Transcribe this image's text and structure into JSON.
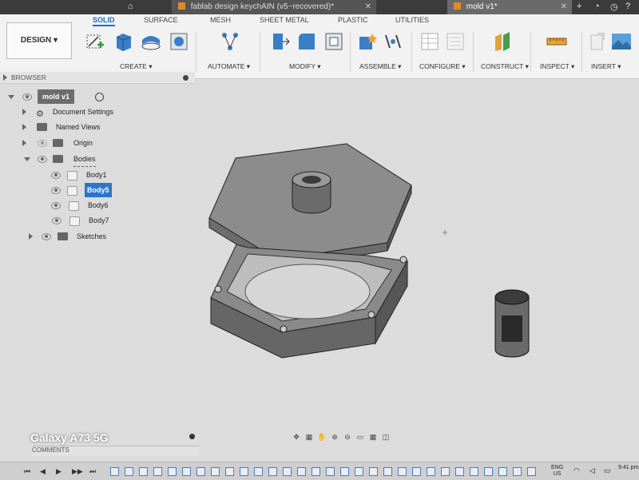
{
  "tabs": {
    "inactive_title": "fablab design keychAIN (v5~recovered)*",
    "active_title": "mold v1*"
  },
  "ribbon": {
    "design_label": "DESIGN ▾",
    "tabs": [
      "SOLID",
      "SURFACE",
      "MESH",
      "SHEET METAL",
      "PLASTIC",
      "UTILITIES"
    ],
    "groups": [
      "CREATE ▾",
      "AUTOMATE ▾",
      "MODIFY ▾",
      "ASSEMBLE ▾",
      "CONFIGURE ▾",
      "CONSTRUCT ▾",
      "INSPECT ▾",
      "INSERT ▾"
    ]
  },
  "browser": {
    "title": "BROWSER",
    "root": "mold v1",
    "items": [
      {
        "label": "Document Settings"
      },
      {
        "label": "Named Views"
      },
      {
        "label": "Origin"
      },
      {
        "label": "Bodies"
      },
      {
        "label": "Body1"
      },
      {
        "label": "Body5",
        "selected": true
      },
      {
        "label": "Body6"
      },
      {
        "label": "Body7"
      },
      {
        "label": "Sketches"
      }
    ]
  },
  "bottom": {
    "watermark": "Galaxy A73 5G",
    "comments": "COMMENTS",
    "tray_lang_1": "ENG",
    "tray_lang_2": "US",
    "tray_time": "9:41 pm"
  },
  "colors": {
    "accent": "#1b6ec2",
    "selection": "#2b76c9",
    "body_gray": "#7a7a7a"
  }
}
